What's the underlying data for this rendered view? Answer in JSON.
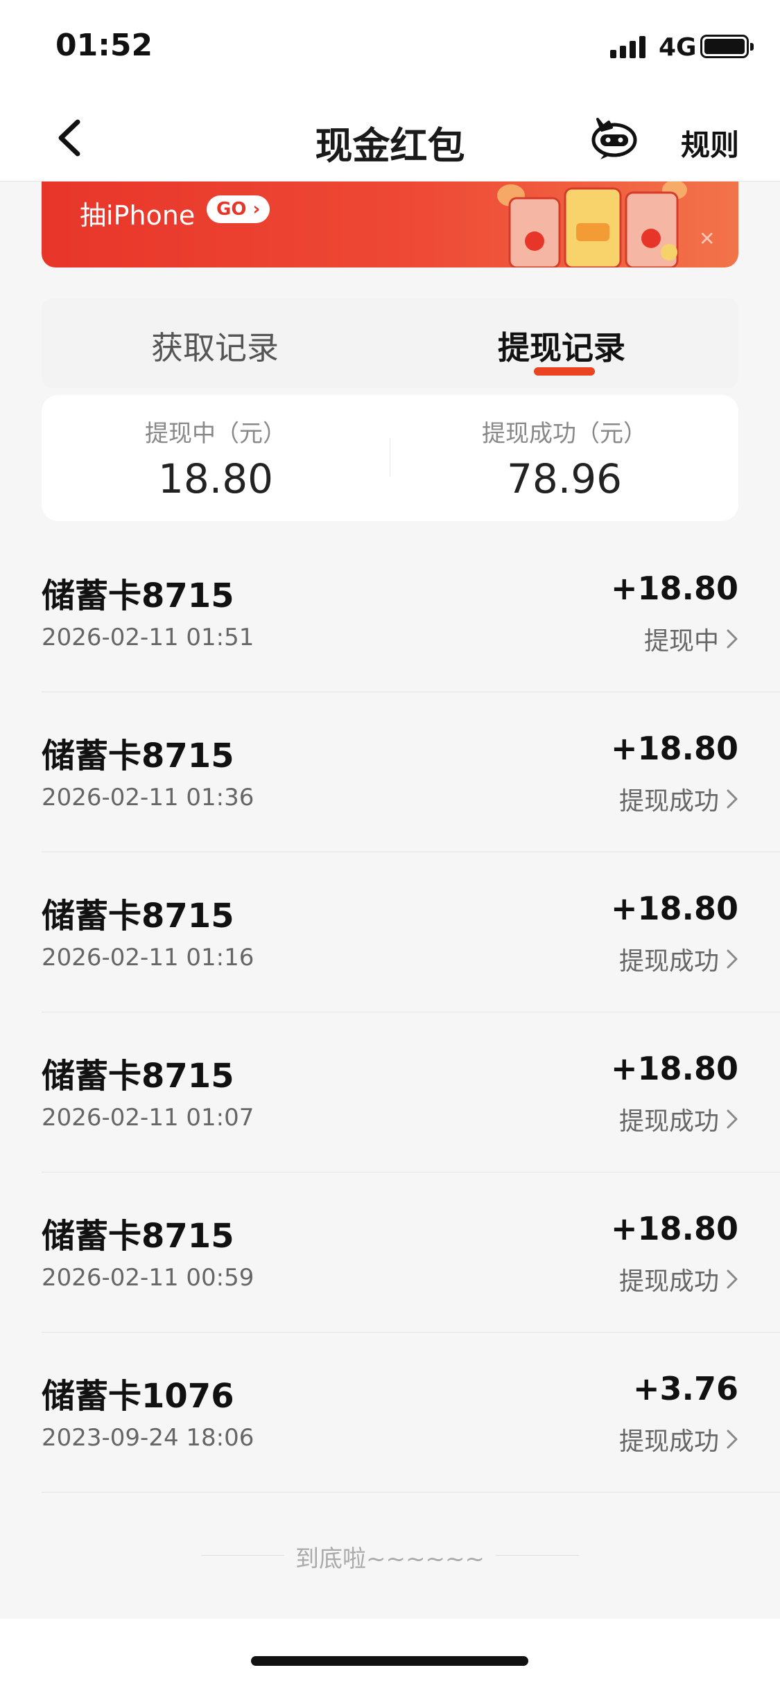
{
  "status_bar": {
    "time": "01:52",
    "network": "4G"
  },
  "nav": {
    "title": "现金红包",
    "rules_label": "规则",
    "back_icon": "chevron-left-icon",
    "mascot_icon": "mascot-icon"
  },
  "banner": {
    "text": "抽iPhone",
    "go_label": "GO",
    "close_icon": "close-icon"
  },
  "tabs": [
    {
      "label": "获取记录",
      "active": false
    },
    {
      "label": "提现记录",
      "active": true
    }
  ],
  "summary": {
    "pending_label": "提现中（元）",
    "pending_value": "18.80",
    "success_label": "提现成功（元）",
    "success_value": "78.96"
  },
  "records": [
    {
      "title": "储蓄卡8715",
      "date": "2026-02-11 01:51",
      "amount": "+18.80",
      "status": "提现中"
    },
    {
      "title": "储蓄卡8715",
      "date": "2026-02-11 01:36",
      "amount": "+18.80",
      "status": "提现成功"
    },
    {
      "title": "储蓄卡8715",
      "date": "2026-02-11 01:16",
      "amount": "+18.80",
      "status": "提现成功"
    },
    {
      "title": "储蓄卡8715",
      "date": "2026-02-11 01:07",
      "amount": "+18.80",
      "status": "提现成功"
    },
    {
      "title": "储蓄卡8715",
      "date": "2026-02-11 00:59",
      "amount": "+18.80",
      "status": "提现成功"
    },
    {
      "title": "储蓄卡1076",
      "date": "2023-09-24 18:06",
      "amount": "+3.76",
      "status": "提现成功"
    }
  ],
  "footer": {
    "end_text": "到底啦~~~~~~"
  },
  "colors": {
    "accent": "#e9431f",
    "banner_start": "#e8352a",
    "banner_end": "#f2734a"
  }
}
